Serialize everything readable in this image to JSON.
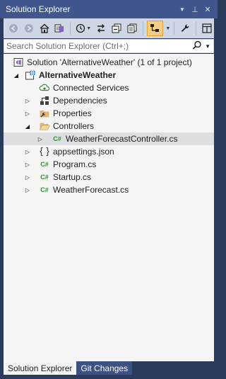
{
  "window": {
    "title": "Solution Explorer",
    "pin_glyph": "⊥",
    "close_glyph": "✕",
    "dropdown_glyph": "▼"
  },
  "toolbar": {
    "icons": [
      "back-icon",
      "forward-icon",
      "home-icon",
      "switch-views-icon",
      "pending-changes-filter-icon",
      "sync-icon",
      "collapse-all-icon",
      "show-all-files-icon",
      "preview-selected-icon",
      "properties-wrench-icon"
    ]
  },
  "search": {
    "placeholder": "Search Solution Explorer (Ctrl+;)"
  },
  "tree": {
    "solution": "Solution 'AlternativeWeather' (1 of 1 project)",
    "project": "AlternativeWeather",
    "items": {
      "connected_services": "Connected Services",
      "dependencies": "Dependencies",
      "properties": "Properties",
      "controllers": "Controllers",
      "weather_controller": "WeatherForecastController.cs",
      "appsettings": "appsettings.json",
      "program": "Program.cs",
      "startup": "Startup.cs",
      "weather_forecast": "WeatherForecast.cs"
    },
    "cs_badge": "C#"
  },
  "tabs": {
    "solution_explorer": "Solution Explorer",
    "git_changes": "Git Changes"
  },
  "colors": {
    "title_bg": "#40568d",
    "toolbar_bg": "#cfd6e5",
    "tree_bg": "#f5f5f5",
    "selected_row": "#dcdee2",
    "cs_green": "#388a34",
    "folder": "#dcb67a",
    "tab_inactive": "#3d5182"
  }
}
